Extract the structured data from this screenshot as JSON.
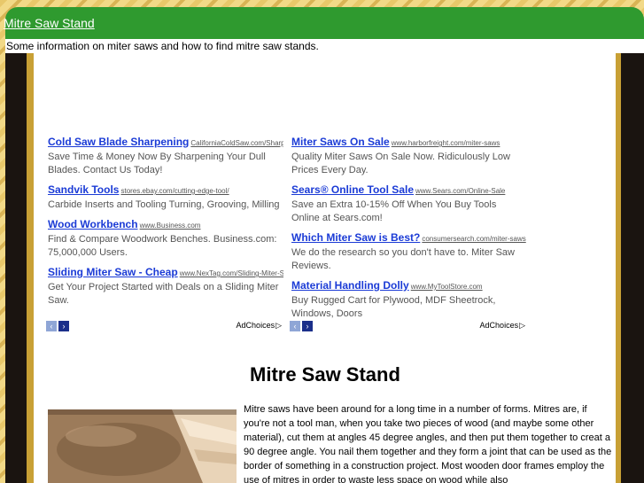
{
  "header": {
    "site_title": "Mitre Saw Stand",
    "tagline": "Some information on miter saws and how to find mitre saw stands."
  },
  "ads": {
    "left": [
      {
        "title": "Cold Saw Blade Sharpening",
        "url": "CaliforniaColdSaw.com/Sharp",
        "desc": "Save Time & Money Now By Sharpening Your Dull Blades. Contact Us Today!"
      },
      {
        "title": "Sandvik Tools",
        "url": "stores.ebay.com/cutting-edge-tool/",
        "desc": "Carbide Inserts and Tooling Turning, Grooving, Milling"
      },
      {
        "title": "Wood Workbench",
        "url": "www.Business.com",
        "desc": "Find & Compare Woodwork Benches. Business.com: 75,000,000 Users."
      },
      {
        "title": "Sliding Miter Saw - Cheap",
        "url": "www.NexTag.com/Sliding-Miter-S",
        "desc": "Get Your Project Started with Deals on a Sliding Miter Saw."
      }
    ],
    "right": [
      {
        "title": "Miter Saws On Sale",
        "url": "www.harborfreight.com/miter-saws",
        "desc": "Quality Miter Saws On Sale Now. Ridiculously Low Prices Every Day."
      },
      {
        "title": "Sears® Online Tool Sale",
        "url": "www.Sears.com/Online-Sale",
        "desc": "Save an Extra 10-15% Off When You Buy Tools Online at Sears.com!"
      },
      {
        "title": "Which Miter Saw is Best?",
        "url": "consumersearch.com/miter-saws",
        "desc": "We do the research so you don't have to. Miter Saw Reviews."
      },
      {
        "title": "Material Handling Dolly",
        "url": "www.MyToolStore.com",
        "desc": "Buy Rugged Cart for Plywood, MDF Sheetrock, Windows, Doors"
      }
    ],
    "adchoices_label": "AdChoices",
    "prev_icon": "‹",
    "next_icon": "›"
  },
  "article": {
    "title": "Mitre Saw Stand",
    "image_icon": "wood-image",
    "text": "Mitre saws have been around for a long time in a number of forms.  Mitres are, if you're not a tool man, when you take two pieces of wood (and maybe some other material), cut them at angles 45 degree angles, and then put them together to creat a 90 degree angle.  You nail them together and they form a joint that can be used as the border of something in a construction project.  Most wooden door frames employ the use of mitres in order to waste less space on wood while also"
  },
  "colors": {
    "header_green": "#2f9a2f",
    "link_blue": "#1b3bd6",
    "frame_dark": "#1a1410",
    "frame_gold": "#c8a035"
  }
}
